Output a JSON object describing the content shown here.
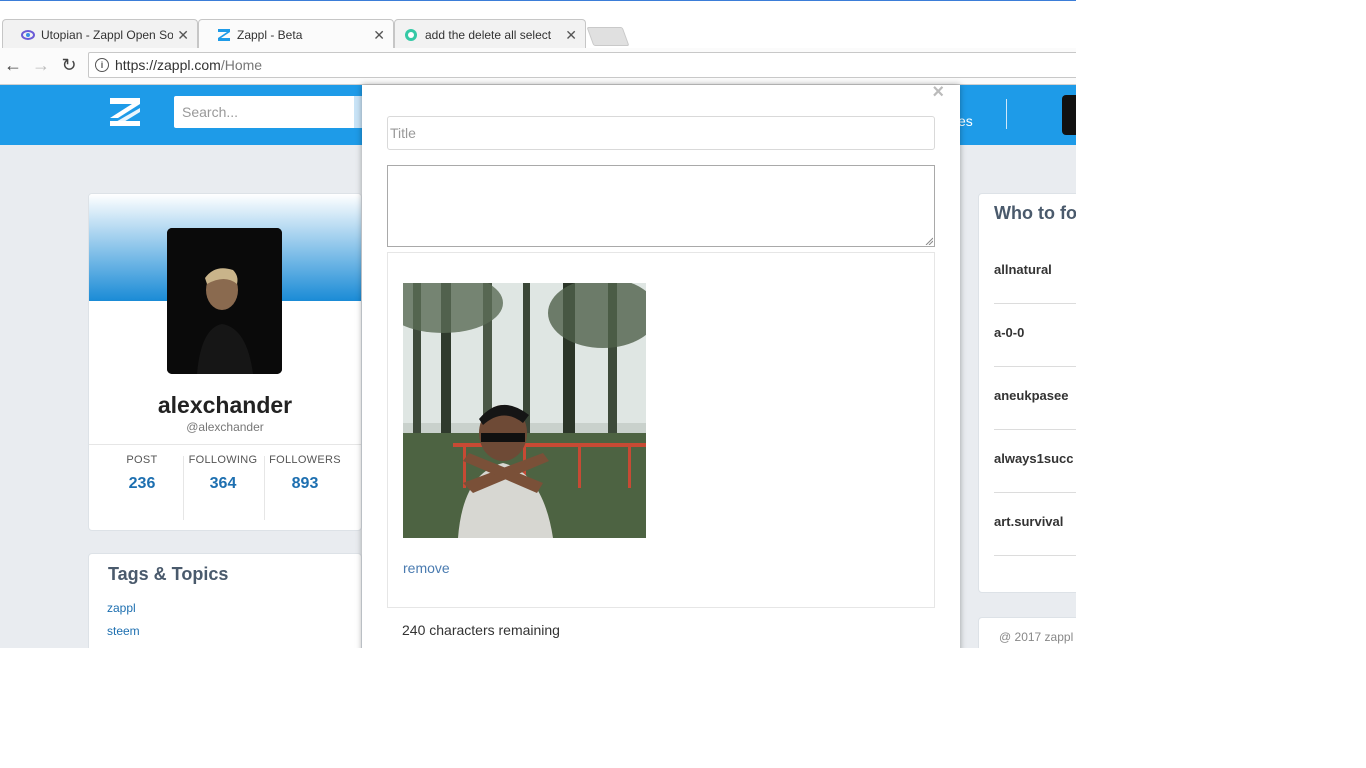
{
  "browser": {
    "tabs": [
      {
        "label": "Utopian - Zappl Open So",
        "close": "✕"
      },
      {
        "label": "Zappl - Beta",
        "close": "✕"
      },
      {
        "label": "add the delete all select",
        "close": "✕"
      }
    ],
    "url_host": "https://zappl.com",
    "url_path": "/Home"
  },
  "header": {
    "search_placeholder": "Search...",
    "nav_partial": "es"
  },
  "profile": {
    "name": "alexchander",
    "handle": "@alexchander",
    "stats": [
      {
        "label": "POST",
        "value": "236"
      },
      {
        "label": "FOLLOWING",
        "value": "364"
      },
      {
        "label": "FOLLOWERS",
        "value": "893"
      }
    ]
  },
  "tags": {
    "title": "Tags & Topics",
    "items": [
      "zappl",
      "steem"
    ]
  },
  "who_to_follow": {
    "title": "Who to fo",
    "users": [
      "allnatural",
      "a-0-0",
      "aneukpasee",
      "always1succ",
      "art.survival"
    ]
  },
  "footer": {
    "copyright": "@ 2017 zappl"
  },
  "modal": {
    "close_label": "×",
    "title_placeholder": "Title",
    "remove_label": "remove",
    "chars_remaining": "240 characters remaining"
  }
}
